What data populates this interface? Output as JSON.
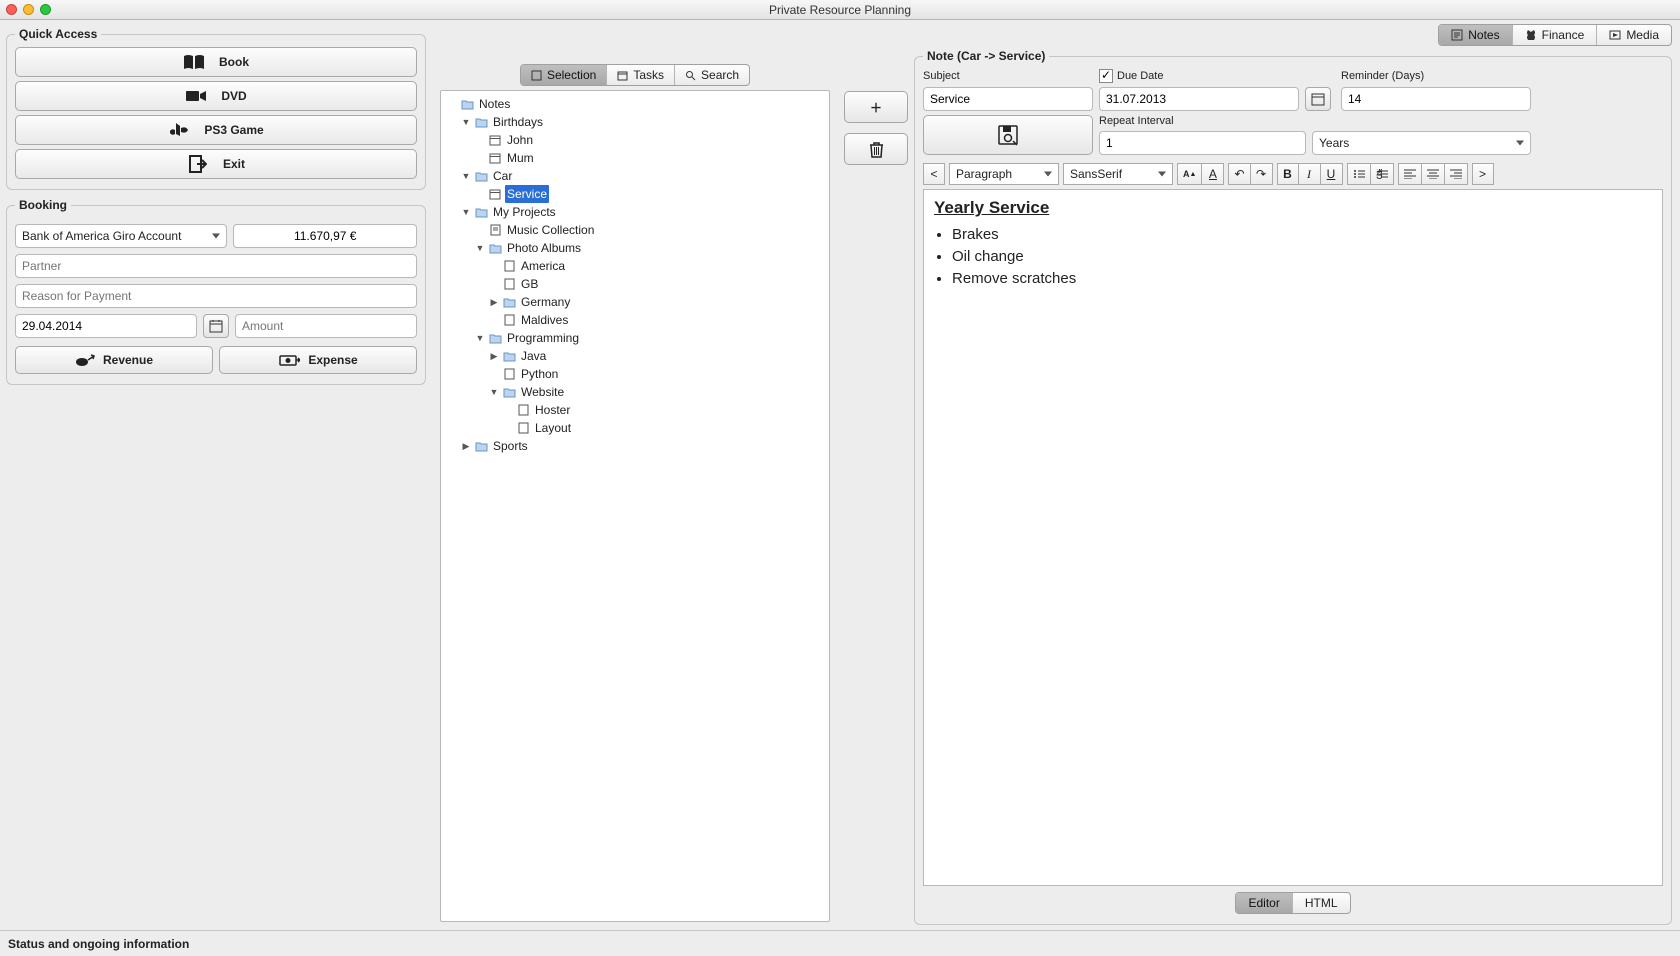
{
  "window": {
    "title": "Private Resource Planning"
  },
  "quickAccess": {
    "legend": "Quick Access",
    "buttons": {
      "book": "Book",
      "dvd": "DVD",
      "ps3": "PS3 Game",
      "exit": "Exit"
    }
  },
  "booking": {
    "legend": "Booking",
    "account": "Bank of America Giro Account",
    "balance": "11.670,97 €",
    "partner_ph": "Partner",
    "reason_ph": "Reason for Payment",
    "date": "29.04.2014",
    "amount_ph": "Amount",
    "revenue": "Revenue",
    "expense": "Expense"
  },
  "topTabs": {
    "notes": "Notes",
    "finance": "Finance",
    "media": "Media"
  },
  "midTabs": {
    "selection": "Selection",
    "tasks": "Tasks",
    "search": "Search"
  },
  "tree": {
    "root": "Notes",
    "birthdays": "Birthdays",
    "john": "John",
    "mum": "Mum",
    "car": "Car",
    "service": "Service",
    "myprojects": "My Projects",
    "music": "Music Collection",
    "albums": "Photo Albums",
    "america": "America",
    "gb": "GB",
    "germany": "Germany",
    "maldives": "Maldives",
    "programming": "Programming",
    "java": "Java",
    "python": "Python",
    "website": "Website",
    "hoster": "Hoster",
    "layout": "Layout",
    "sports": "Sports"
  },
  "note": {
    "legend": "Note (Car -> Service)",
    "subject_lbl": "Subject",
    "subject": "Service",
    "duedate_lbl": "Due Date",
    "duedate": "31.07.2013",
    "reminder_lbl": "Reminder (Days)",
    "reminder": "14",
    "repeat_lbl": "Repeat Interval",
    "repeat_val": "1",
    "repeat_unit": "Years",
    "fmt_paragraph": "Paragraph",
    "fmt_font": "SansSerif",
    "content_title": "Yearly Service",
    "bullets": [
      "Brakes",
      "Oil change",
      "Remove scratches"
    ],
    "tab_editor": "Editor",
    "tab_html": "HTML"
  },
  "status": "Status and ongoing information"
}
